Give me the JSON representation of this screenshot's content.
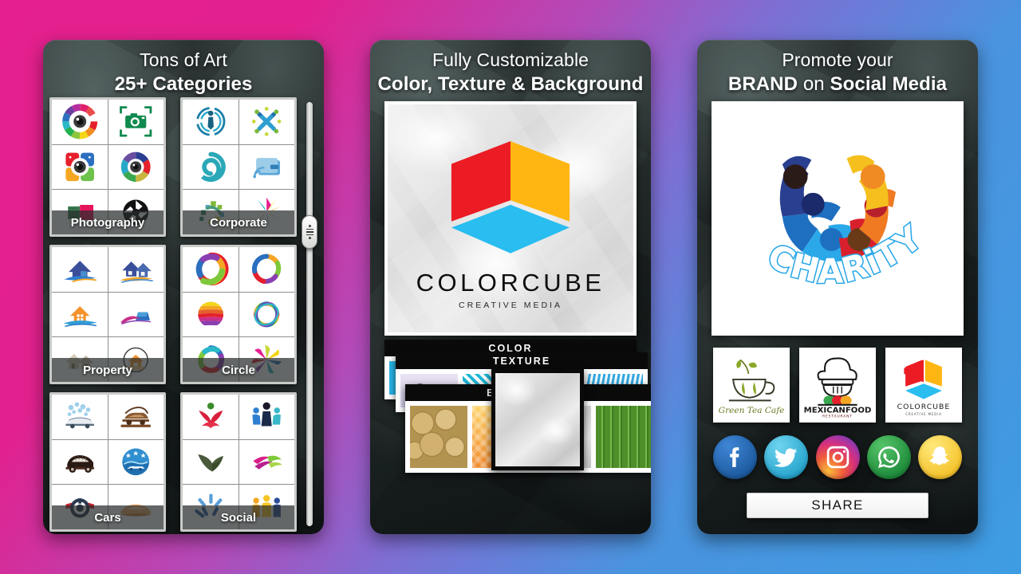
{
  "background": {
    "gradient_from": "#e5208e",
    "gradient_to": "#3e9ce2"
  },
  "panels": [
    {
      "id": "art",
      "heading_line1": "Tons of Art",
      "heading_line2": "25+ Categories",
      "categories": [
        {
          "label": "Photography"
        },
        {
          "label": "Corporate"
        },
        {
          "label": "Property"
        },
        {
          "label": "Circle"
        },
        {
          "label": "Cars"
        },
        {
          "label": "Social"
        }
      ],
      "scrollbar": {
        "name": "vertical-scrollbar",
        "thumb_position_pct": 27
      }
    },
    {
      "id": "customize",
      "heading_line1": "Fully Customizable",
      "heading_line2": "Color, Texture & Background",
      "preview": {
        "brand_name": "COLORCUBE",
        "brand_tagline": "CREATIVE MEDIA",
        "cube_colors": {
          "left": "#ec1c24",
          "right": "#ffb612",
          "bottom": "#29bdf0"
        },
        "background_texture": "crumpled-paper"
      },
      "stacks": [
        {
          "title": "COLOR",
          "swatches": [
            "#29b6e8",
            "#e51f26",
            "#1aa84f",
            "#f5e613"
          ]
        },
        {
          "title": "TEXTURE",
          "swatches": [
            "texture-floral",
            "texture-damask",
            "texture-confetti",
            "texture-rain"
          ]
        },
        {
          "title": "BACKGROUND",
          "swatches": [
            "wood-logs",
            "orange-weave",
            "crumpled-paper",
            "bamboo"
          ]
        }
      ],
      "selected_background": "crumpled-paper"
    },
    {
      "id": "promote",
      "heading_line1": "Promote your",
      "heading_line2_bold1": "BRAND",
      "heading_line2_regular": " on ",
      "heading_line2_bold2": "Social Media",
      "preview": {
        "logo_name": "CHARiTY",
        "logo_type": "people-circle"
      },
      "thumbnails": [
        {
          "name": "Green Tea Cafe",
          "tagline": ""
        },
        {
          "name": "MEXICANFOOD",
          "tagline": "RESTAURANT"
        },
        {
          "name": "COLORCUBE",
          "tagline": "CREATIVE MEDIA"
        }
      ],
      "social_networks": [
        {
          "name": "facebook",
          "color": "#2a6bb0"
        },
        {
          "name": "twitter",
          "color": "#3cb3da"
        },
        {
          "name": "instagram",
          "color": "#d6307f"
        },
        {
          "name": "whatsapp",
          "color": "#26a84a"
        },
        {
          "name": "snapchat",
          "color": "#f5c32c"
        }
      ],
      "share_button_label": "SHARE"
    }
  ]
}
